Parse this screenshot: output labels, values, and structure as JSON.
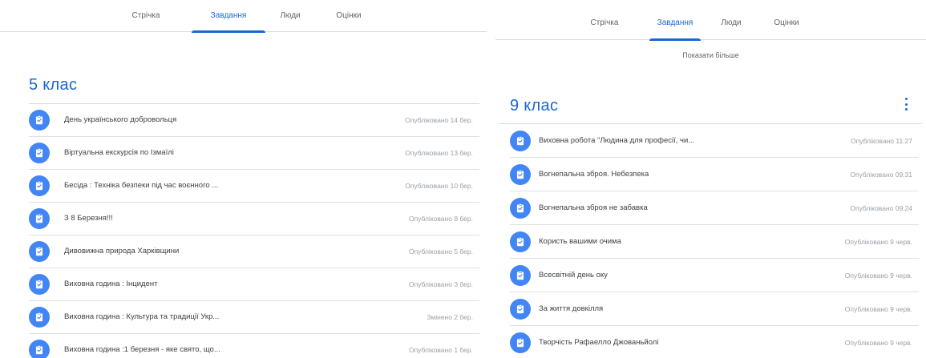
{
  "left": {
    "tabs": [
      {
        "label": "Стрічка",
        "active": false
      },
      {
        "label": "Завдання",
        "active": true
      },
      {
        "label": "Люди",
        "active": false
      },
      {
        "label": "Оцінки",
        "active": false
      }
    ],
    "class_title": "5 клас",
    "items": [
      {
        "title": "День українського добровольця",
        "date": "Опубліковано 14 бер."
      },
      {
        "title": "Віртуальна екскурсія по Ізмаїлі",
        "date": "Опубліковано 13 бер."
      },
      {
        "title": "Бесіда : Техніка безпеки під час воєнного ...",
        "date": "Опубліковано 10 бер."
      },
      {
        "title": "З 8 Березня!!!",
        "date": "Опубліковано 8 бер."
      },
      {
        "title": "Дивовижна природа Харківщини",
        "date": "Опубліковано 5 бер."
      },
      {
        "title": "Виховна година : Інцидент",
        "date": "Опубліковано 3 бер."
      },
      {
        "title": "Виховна година : Культура та традиції Укр...",
        "date": "Змінено 2 бер."
      },
      {
        "title": "Виховна година :1 березня - яке свято, що...",
        "date": "Опубліковано 1 бер."
      }
    ],
    "colors": {
      "accent": "#1967d2",
      "icon_bg": "#4285f4"
    },
    "icon": "assignment-icon"
  },
  "right": {
    "tabs": [
      {
        "label": "Стрічка",
        "active": false
      },
      {
        "label": "Завдання",
        "active": true
      },
      {
        "label": "Люди",
        "active": false
      },
      {
        "label": "Оцінки",
        "active": false
      }
    ],
    "show_more": "Показати більше",
    "class_title": "9 клас",
    "items": [
      {
        "title": "Виховна робота \"Людина для професії, чи...",
        "date": "Опубліковано 11:27"
      },
      {
        "title": "Вогнепальна зброя. Небезпека",
        "date": "Опубліковано 09:31"
      },
      {
        "title": "Вогнепальна зброя не забавка",
        "date": "Опубліковано 09:24"
      },
      {
        "title": "Користь вашими очима",
        "date": "Опубліковано 9 черв."
      },
      {
        "title": "Всесвітній день оку",
        "date": "Опубліковано 9 черв."
      },
      {
        "title": "За життя довкілля",
        "date": "Опубліковано 9 черв."
      },
      {
        "title": "Творчість Рафаелло Джованьйолі",
        "date": "Опубліковано 9 черв."
      }
    ],
    "colors": {
      "accent": "#1967d2",
      "icon_bg": "#4285f4"
    },
    "icon": "assignment-icon"
  }
}
